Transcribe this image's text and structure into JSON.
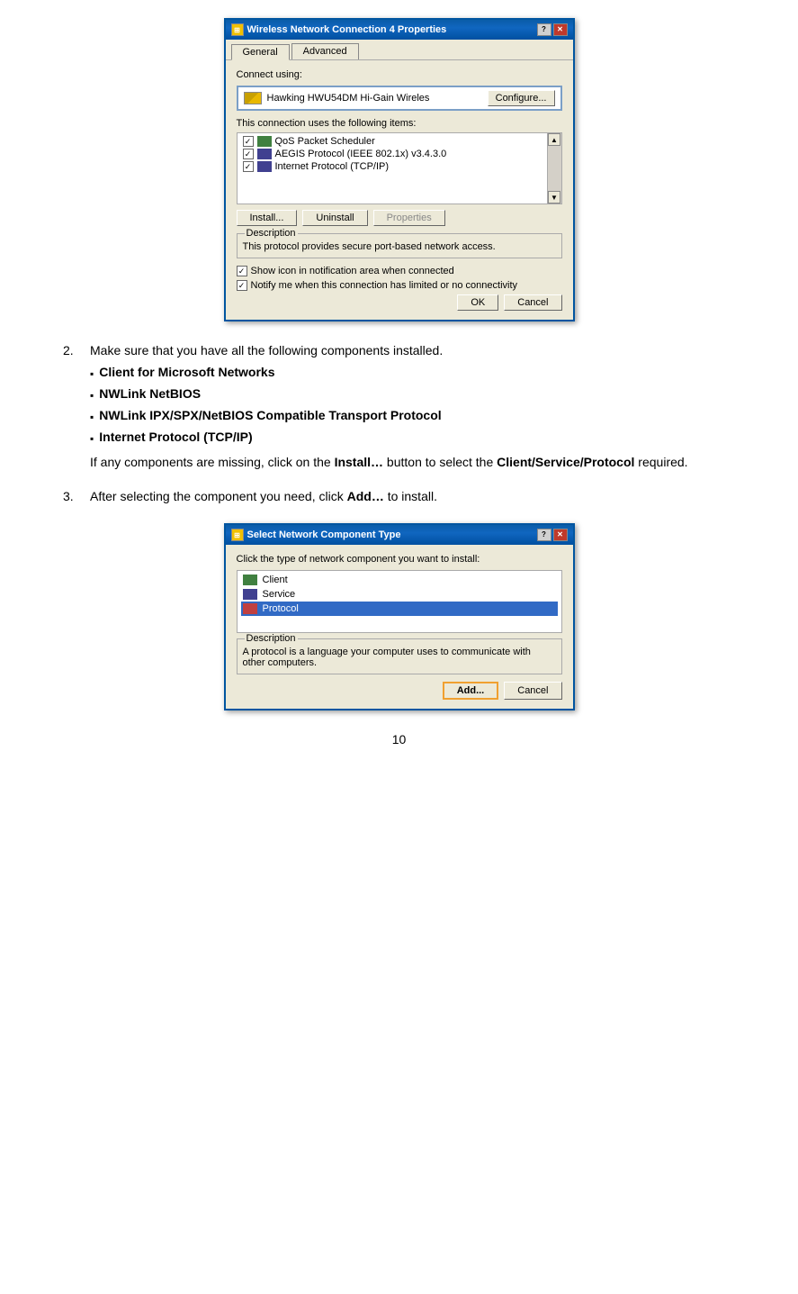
{
  "page": {
    "number": "10"
  },
  "dialog1": {
    "title": "Wireless Network Connection 4 Properties",
    "tabs": [
      "General",
      "Advanced"
    ],
    "connect_label": "Connect using:",
    "device_name": "Hawking HWU54DM Hi-Gain Wireles",
    "configure_btn": "Configure...",
    "items_label": "This connection uses the following items:",
    "items": [
      {
        "label": "QoS Packet Scheduler",
        "checked": true,
        "icon_color": "#408040"
      },
      {
        "label": "AEGIS Protocol (IEEE 802.1x) v3.4.3.0",
        "checked": true,
        "icon_color": "#404090"
      },
      {
        "label": "Internet Protocol (TCP/IP)",
        "checked": true,
        "icon_color": "#404090"
      }
    ],
    "install_btn": "Install...",
    "uninstall_btn": "Uninstall",
    "properties_btn": "Properties",
    "description_label": "Description",
    "description_text": "This protocol provides secure port-based network access.",
    "show_icon_label": "Show icon in notification area when connected",
    "notify_label": "Notify me when this connection has limited or no connectivity",
    "ok_btn": "OK",
    "cancel_btn": "Cancel"
  },
  "step2": {
    "number": "2.",
    "text": "Make sure that you have all the following components installed.",
    "bullets": [
      "Client for Microsoft Networks",
      "NWLink NetBIOS",
      "NWLink IPX/SPX/NetBIOS Compatible Transport Protocol",
      "Internet Protocol (TCP/IP)"
    ],
    "inline_text_pre": "If any components are missing, click on the ",
    "install_bold": "Install…",
    "inline_text_mid": " button to select the ",
    "csp_bold": "Client/Service/Protocol",
    "inline_text_post": " required."
  },
  "step3": {
    "number": "3.",
    "text_pre": "After selecting the component you need, click ",
    "add_bold": "Add…",
    "text_post": " to install."
  },
  "dialog2": {
    "title": "Select Network Component Type",
    "click_label": "Click the type of network component you want to install:",
    "items": [
      {
        "label": "Client",
        "selected": false
      },
      {
        "label": "Service",
        "selected": false
      },
      {
        "label": "Protocol",
        "selected": true
      }
    ],
    "description_label": "Description",
    "description_text": "A protocol is a language your computer uses to communicate with other computers.",
    "add_btn": "Add...",
    "cancel_btn": "Cancel"
  }
}
